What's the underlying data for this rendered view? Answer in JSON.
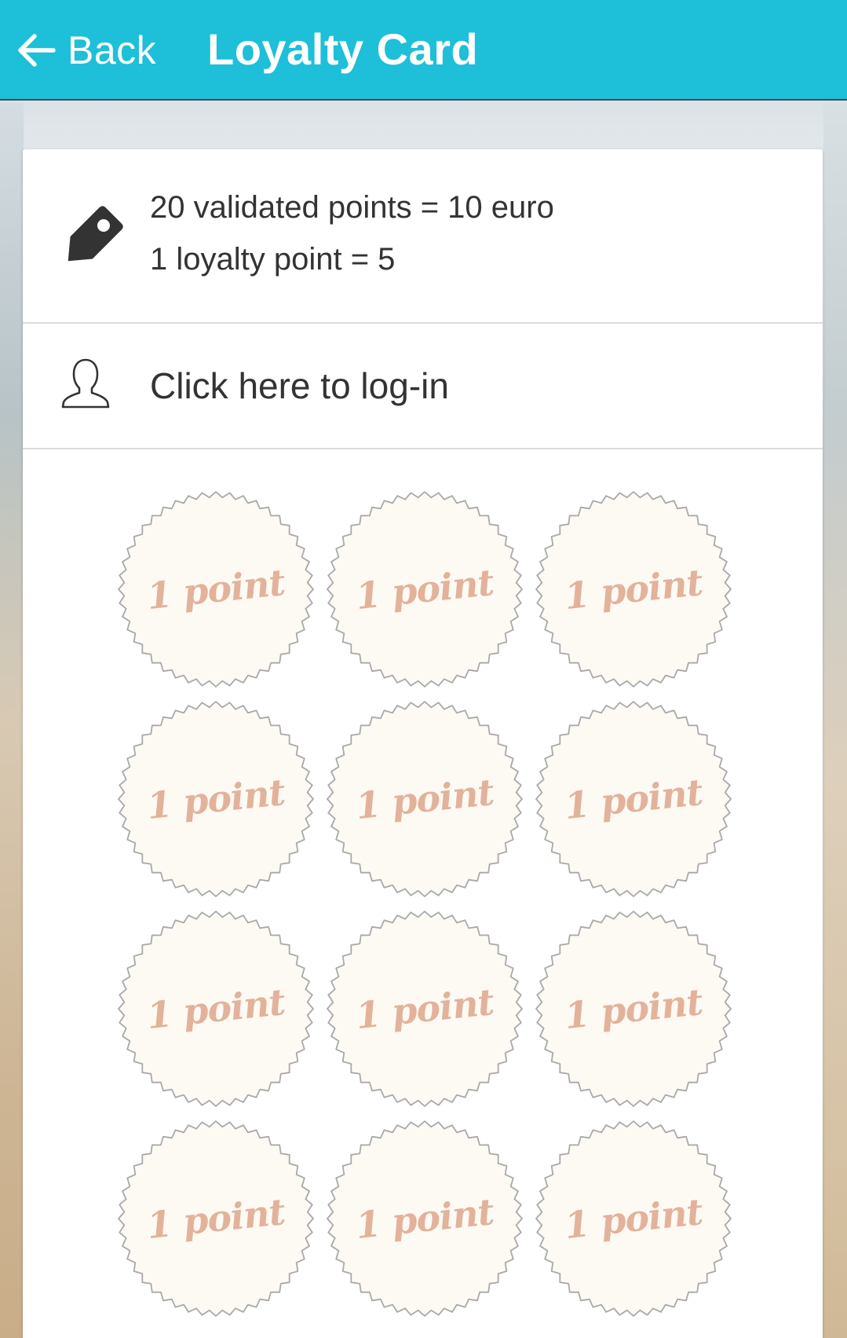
{
  "header": {
    "back_label": "Back",
    "title": "Loyalty Card",
    "background_color": "#1ebfd8"
  },
  "info": {
    "icon": "tag-icon",
    "line1": "20 validated points = 10 euro",
    "line2": "1 loyalty point = 5"
  },
  "login": {
    "icon": "user-icon",
    "label": "Click here to log-in"
  },
  "stamps": {
    "label": "1 point",
    "label_color": "#e3b29b",
    "items": [
      "1 point",
      "1 point",
      "1 point",
      "1 point",
      "1 point",
      "1 point",
      "1 point",
      "1 point",
      "1 point",
      "1 point",
      "1 point",
      "1 point"
    ]
  }
}
